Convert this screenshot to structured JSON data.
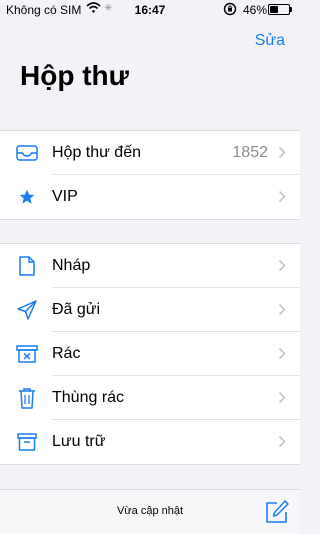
{
  "status_bar": {
    "carrier": "Không có SIM",
    "time": "16:47",
    "battery": "46%",
    "battery_level": 0.46
  },
  "header": {
    "edit_label": "Sửa",
    "title": "Hộp thư"
  },
  "mailboxes": [
    {
      "label": "Hộp thư đến",
      "count": "1852",
      "icon": "inbox-tray-icon"
    },
    {
      "label": "VIP",
      "count": "",
      "icon": "star-icon"
    }
  ],
  "folders": [
    {
      "label": "Nháp",
      "icon": "document-icon"
    },
    {
      "label": "Đã gửi",
      "icon": "paper-plane-icon"
    },
    {
      "label": "Rác",
      "icon": "junk-box-icon"
    },
    {
      "label": "Thùng rác",
      "icon": "trash-icon"
    },
    {
      "label": "Lưu trữ",
      "icon": "archive-box-icon"
    }
  ],
  "toolbar": {
    "status": "Vừa cập nhật",
    "compose_icon": "compose-icon"
  },
  "colors": {
    "accent": "#1a7cf2",
    "background": "#f2f2f7",
    "secondary_text": "#8e8e93"
  }
}
